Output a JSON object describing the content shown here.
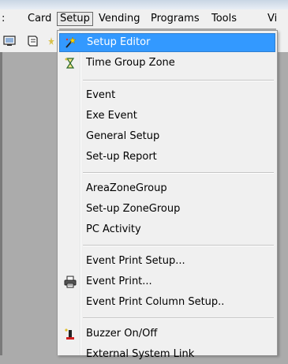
{
  "menubar": {
    "items": [
      {
        "label": ":"
      },
      {
        "label": "Card"
      },
      {
        "label": "Setup"
      },
      {
        "label": "Vending"
      },
      {
        "label": "Programs"
      },
      {
        "label": "Tools"
      },
      {
        "label": "Vi"
      }
    ]
  },
  "toolbar": {
    "icons": [
      "monitor-icon",
      "document-icon",
      "star-icon"
    ]
  },
  "setup_menu": {
    "items": [
      {
        "label": "Setup Editor",
        "icon": "wand-icon",
        "highlighted": true
      },
      {
        "label": "Time Group Zone",
        "icon": "hourglass-icon"
      },
      {
        "label": "Event"
      },
      {
        "label": "Exe Event"
      },
      {
        "label": "General Setup"
      },
      {
        "label": "Set-up Report"
      },
      {
        "label": "AreaZoneGroup"
      },
      {
        "label": "Set-up ZoneGroup"
      },
      {
        "label": "PC Activity"
      },
      {
        "label": "Event Print Setup..."
      },
      {
        "label": "Event Print...",
        "icon": "printer-icon"
      },
      {
        "label": "Event Print Column Setup.."
      },
      {
        "label": "Buzzer On/Off",
        "icon": "buzzer-icon"
      },
      {
        "label": "External System Link"
      }
    ]
  },
  "colors": {
    "highlight": "#3399ff",
    "menu_background": "#f0f0f0",
    "workspace": "#ababab"
  }
}
